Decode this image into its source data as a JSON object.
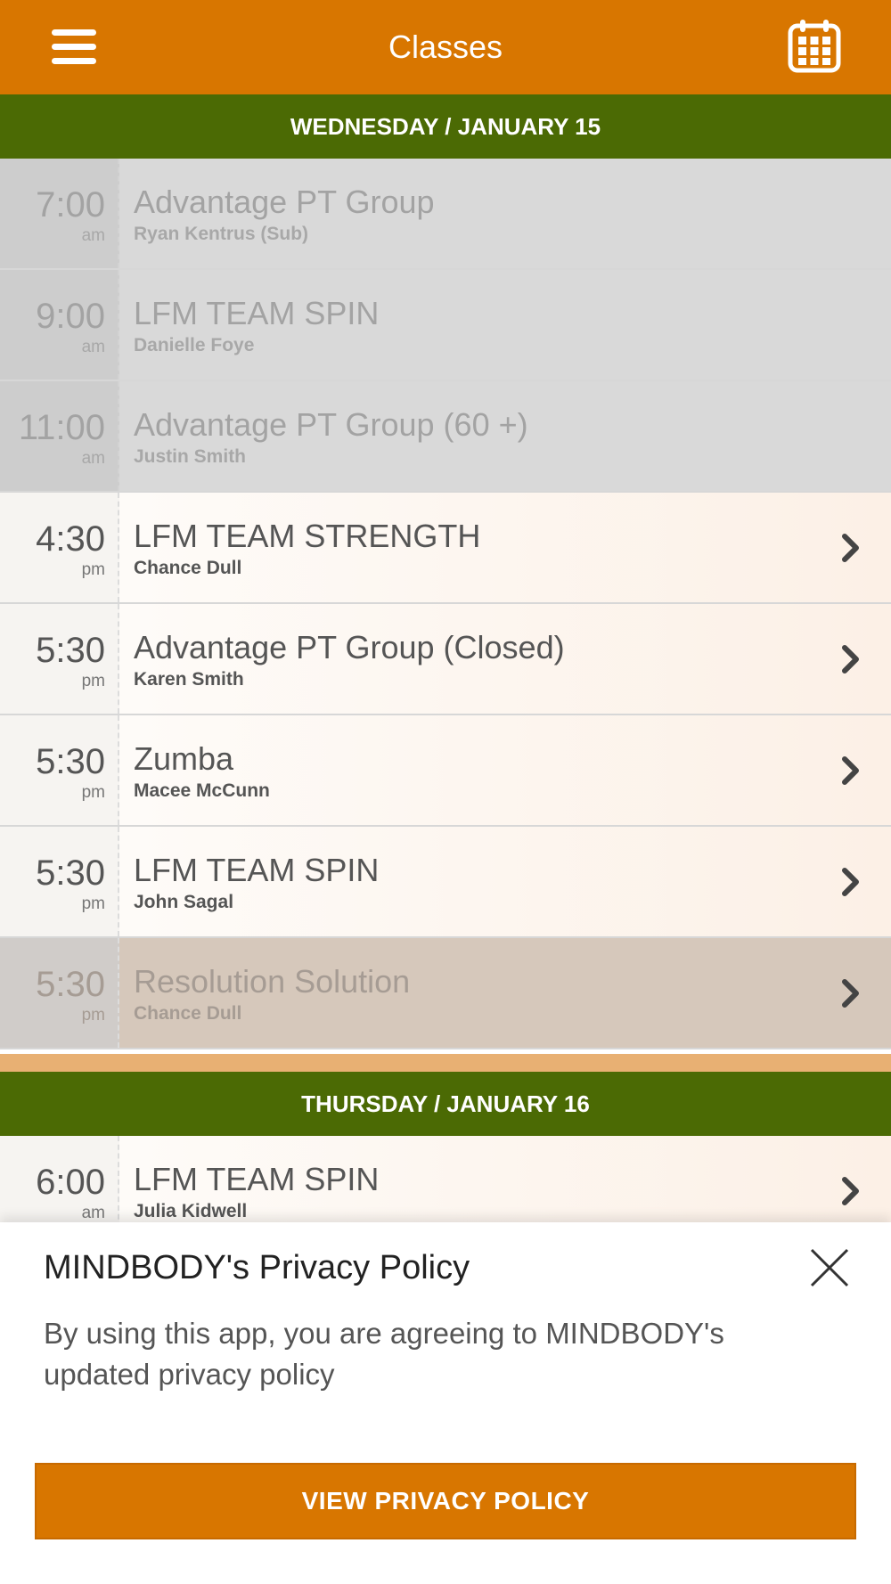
{
  "app_bar": {
    "title": "Classes",
    "menu_icon": "hamburger-menu-icon",
    "calendar_icon": "calendar-icon"
  },
  "schedule": [
    {
      "day_label": "WEDNESDAY / JANUARY 15",
      "classes": [
        {
          "time": "7:00",
          "ampm": "am",
          "name": "Advantage PT Group",
          "instructor": "Ryan Kentrus (Sub)",
          "state": "past"
        },
        {
          "time": "9:00",
          "ampm": "am",
          "name": "LFM TEAM SPIN",
          "instructor": "Danielle Foye",
          "state": "past"
        },
        {
          "time": "11:00",
          "ampm": "am",
          "name": "Advantage PT Group (60 +)",
          "instructor": "Justin Smith",
          "state": "past"
        },
        {
          "time": "4:30",
          "ampm": "pm",
          "name": "LFM TEAM STRENGTH",
          "instructor": "Chance Dull",
          "state": "active"
        },
        {
          "time": "5:30",
          "ampm": "pm",
          "name": "Advantage PT Group (Closed)",
          "instructor": "Karen Smith",
          "state": "active"
        },
        {
          "time": "5:30",
          "ampm": "pm",
          "name": "Zumba",
          "instructor": "Macee McCunn",
          "state": "active"
        },
        {
          "time": "5:30",
          "ampm": "pm",
          "name": "LFM TEAM SPIN",
          "instructor": "John Sagal",
          "state": "active"
        },
        {
          "time": "5:30",
          "ampm": "pm",
          "name": "Resolution Solution",
          "instructor": "Chance Dull",
          "state": "dim"
        }
      ]
    },
    {
      "day_label": "THURSDAY / JANUARY 16",
      "classes": [
        {
          "time": "6:00",
          "ampm": "am",
          "name": "LFM TEAM SPIN",
          "instructor": "Julia Kidwell",
          "state": "active"
        }
      ]
    }
  ],
  "privacy_sheet": {
    "title": "MINDBODY's Privacy Policy",
    "body": "By using this app, you are agreeing to MINDBODY's updated privacy policy",
    "button_label": "VIEW PRIVACY POLICY",
    "close_icon": "close-icon"
  },
  "colors": {
    "brand_orange": "#d87600",
    "day_header_green": "#4b6a04",
    "past_row": "#d9d9d9",
    "active_row": "#fcf0e6"
  }
}
